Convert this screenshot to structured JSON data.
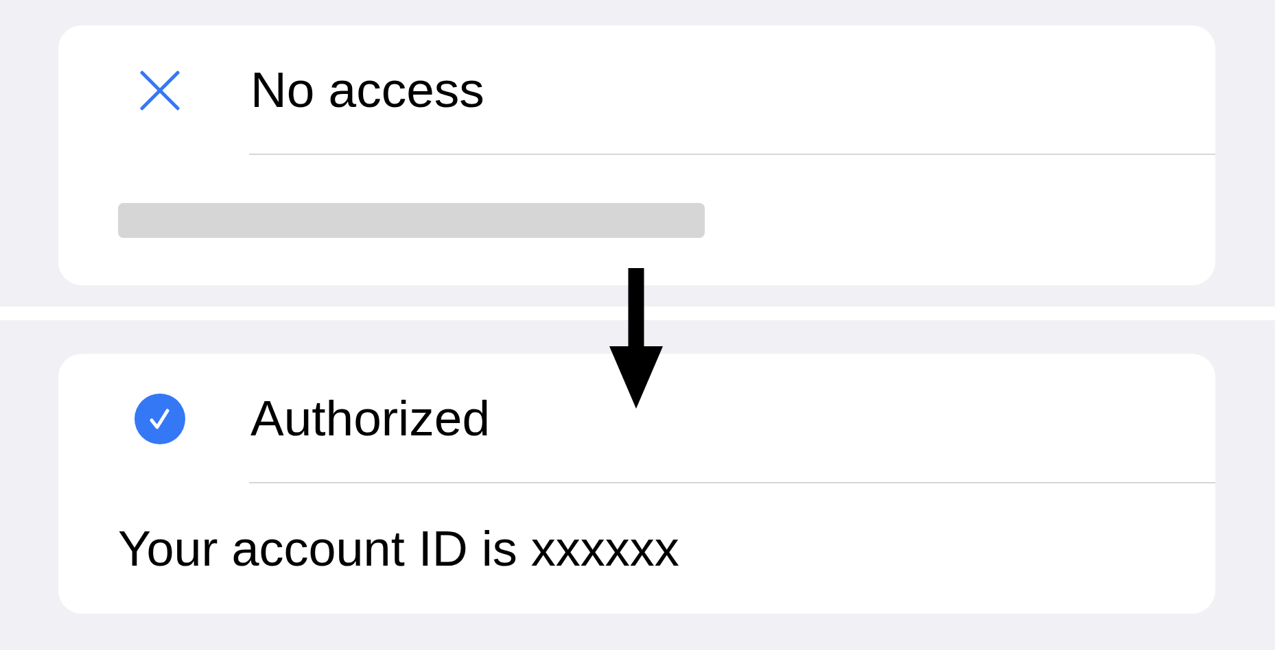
{
  "panels": [
    {
      "status": {
        "kind": "denied",
        "label": "No access"
      },
      "detail": {
        "kind": "redacted"
      }
    },
    {
      "status": {
        "kind": "authorized",
        "label": "Authorized"
      },
      "detail": {
        "kind": "text",
        "text": "Your account ID is xxxxxx"
      }
    }
  ],
  "annotation": {
    "kind": "arrow"
  }
}
